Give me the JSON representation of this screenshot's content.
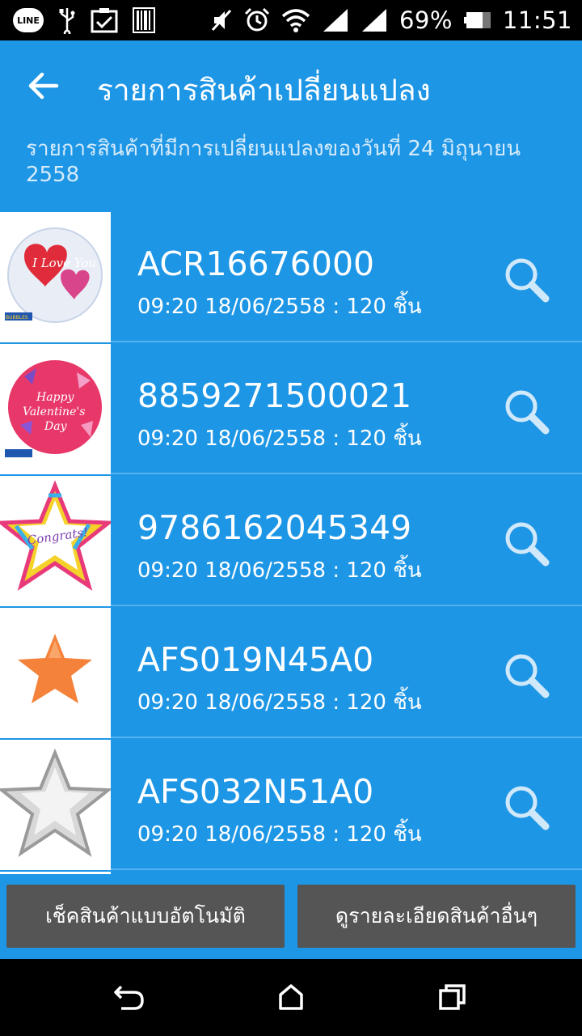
{
  "status_bar": {
    "line_label": "LINE",
    "battery": "69%",
    "time": "11:51",
    "icons": [
      "line-icon",
      "usb-icon",
      "clipboard-check-icon",
      "barcode-icon",
      "mute-icon",
      "alarm-icon",
      "wifi-icon",
      "signal-icon",
      "signal-roaming-icon",
      "battery-icon"
    ]
  },
  "toolbar": {
    "title": "รายการสินค้าเปลี่ยนแปลง",
    "back_icon": "arrow-left-icon"
  },
  "subtitle": "รายการสินค้าที่มีการเปลี่ยนแปลงของวันที่ 24 มิถุนายน 2558",
  "items": [
    {
      "code": "ACR16676000",
      "meta": "09:20 18/06/2558 : 120 ชิ้น",
      "image": "i-love-you-balloon"
    },
    {
      "code": "8859271500021",
      "meta": "09:20 18/06/2558 : 120 ชิ้น",
      "image": "happy-valentines-day-balloon"
    },
    {
      "code": "9786162045349",
      "meta": "09:20 18/06/2558 : 120 ชิ้น",
      "image": "congrats-star-balloon"
    },
    {
      "code": "AFS019N45A0",
      "meta": "09:20 18/06/2558 : 120 ชิ้น",
      "image": "orange-star-balloon"
    },
    {
      "code": "AFS032N51A0",
      "meta": "09:20 18/06/2558 : 120 ชิ้น",
      "image": "silver-star-balloon"
    }
  ],
  "thumb_labels": {
    "love": "I Love You",
    "valentine_1": "Happy",
    "valentine_2": "Valentine's",
    "valentine_3": "Day",
    "congrats": "Congrats!",
    "bubbles": "BUBBLES"
  },
  "buttons": {
    "auto_check": "เช็คสินค้าแบบอัตโนมัติ",
    "other_details": "ดูรายละเอียดสินค้าอื่นๆ"
  },
  "nav": {
    "icons": [
      "back-nav-icon",
      "home-nav-icon",
      "recents-nav-icon"
    ]
  },
  "colors": {
    "primary": "#1e96e6",
    "button": "#555555",
    "search_icon": "#cfe8fa"
  }
}
